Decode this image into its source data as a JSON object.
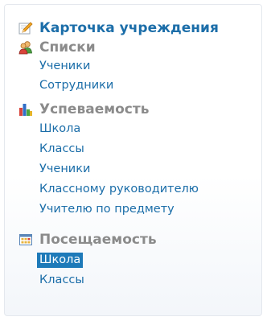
{
  "menu": {
    "card": {
      "label": "Карточка учреждения",
      "icon": "pencil-icon"
    },
    "lists": {
      "label": "Списки",
      "icon": "users-icon",
      "items": [
        "Ученики",
        "Сотрудники"
      ]
    },
    "performance": {
      "label": "Успеваемость",
      "icon": "bar-chart-icon",
      "items": [
        "Школа",
        "Классы",
        "Ученики",
        "Классному руководителю",
        "Учителю по предмету"
      ]
    },
    "attendance": {
      "label": "Посещаемость",
      "icon": "calendar-grid-icon",
      "items": [
        "Школа",
        "Классы"
      ],
      "selected_index": 0
    }
  },
  "colors": {
    "link": "#1c6ea9",
    "header_gray": "#8b8b8b",
    "selected_bg": "#1e7ab9",
    "selected_text": "#ffffff"
  }
}
